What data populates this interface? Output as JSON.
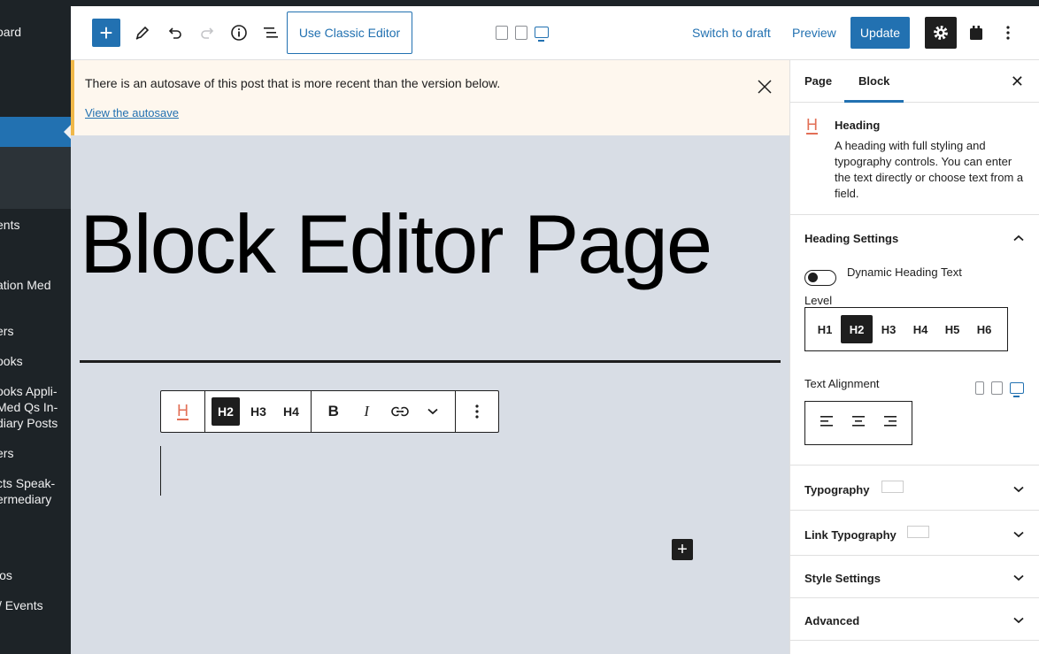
{
  "admin_sidebar": {
    "items": [
      "oard",
      "ents",
      "ation Med",
      "ers",
      "ooks",
      "ooks Appli-",
      "Med Qs In-",
      "diary Posts",
      "ers",
      "cts Speak-",
      "ermediary",
      "ios",
      "/ Events"
    ]
  },
  "toolbar": {
    "add_label": "+",
    "classic_label": "Use Classic Editor",
    "switch_draft_label": "Switch to draft",
    "preview_label": "Preview",
    "update_label": "Update"
  },
  "notice": {
    "message": "There is an autosave of this post that is more recent than the version below.",
    "link": "View the autosave"
  },
  "canvas": {
    "page_title": "Block Editor Page"
  },
  "block_toolbar": {
    "levels": [
      "H2",
      "H3",
      "H4"
    ],
    "bold": "B",
    "italic": "I"
  },
  "panel": {
    "tabs": [
      "Page",
      "Block"
    ],
    "block": {
      "name": "Heading",
      "description": "A heading with full styling and typography controls. You can enter the text directly or choose text from a field."
    },
    "heading_settings": {
      "title": "Heading Settings",
      "dynamic_label": "Dynamic Heading Text",
      "level_label": "Level",
      "levels": [
        "H1",
        "H2",
        "H3",
        "H4",
        "H5",
        "H6"
      ],
      "active_level": "H2",
      "alignment_label": "Text Alignment"
    },
    "sections": [
      "Typography",
      "Link Typography",
      "Style Settings",
      "Advanced"
    ]
  },
  "colors": {
    "accent": "#2271b1",
    "heading_icon": "#e26f56",
    "notice_bg": "#fef7ee",
    "canvas_bg": "#d8dde5"
  }
}
